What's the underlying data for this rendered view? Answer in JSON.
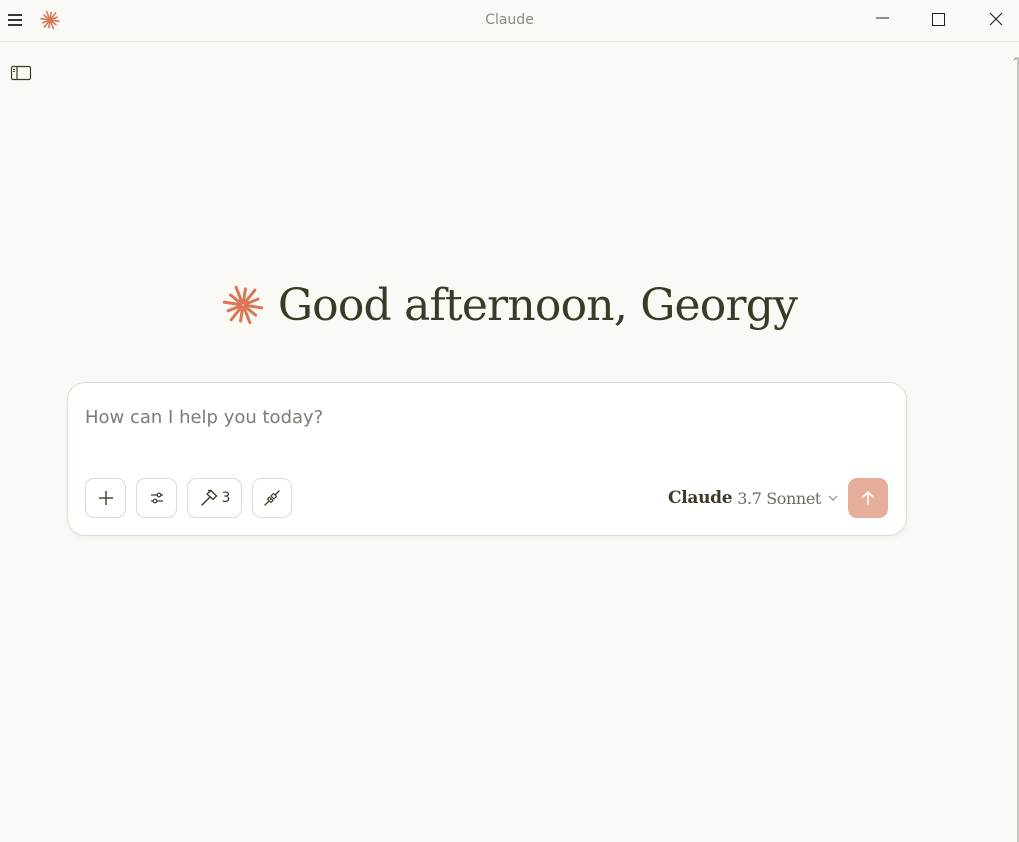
{
  "window": {
    "title": "Claude",
    "controls": [
      "minimize",
      "maximize",
      "close"
    ]
  },
  "icons": {
    "menu": "menu-icon",
    "logo": "claude-logo-icon",
    "sidebar": "sidebar-toggle-icon",
    "add": "plus-icon",
    "settings": "sliders-icon",
    "tools": "hammer-icon",
    "connect": "plug-icon",
    "send": "arrow-up-icon"
  },
  "greeting": {
    "text": "Good afternoon, Georgy"
  },
  "composer": {
    "placeholder": "How can I help you today?",
    "tools_count": "3",
    "model": {
      "name": "Claude",
      "version": "3.7 Sonnet"
    }
  },
  "colors": {
    "background": "#faf9f5",
    "accent": "#d97757",
    "send_button": "#e6ae9b"
  }
}
